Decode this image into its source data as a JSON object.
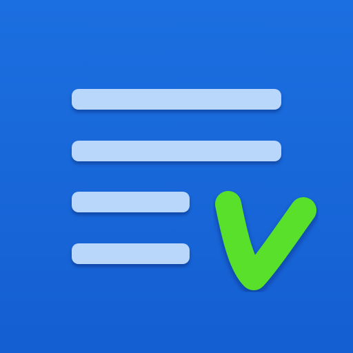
{
  "icon": {
    "description_name": "checklist-app-icon",
    "colors": {
      "background": "#1565d8",
      "lines": "#b9d6fb",
      "checkmark": "#58e02a"
    },
    "list_line_count": 4,
    "checkmark_icon": "checkmark-icon"
  }
}
